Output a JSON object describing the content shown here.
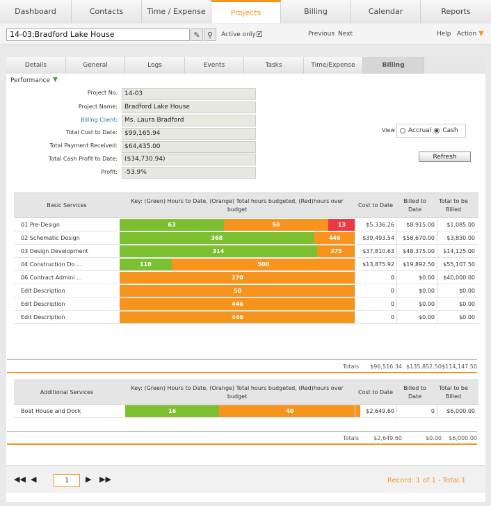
{
  "nav": {
    "tabs": [
      "Dashboard",
      "Contacts",
      "Time / Expense",
      "Projects",
      "Billing",
      "Calendar",
      "Reports"
    ],
    "active": "Projects"
  },
  "toolbar": {
    "project_select": "14-03:Bradford Lake House",
    "active_only": "Active only",
    "active_checked": "✔",
    "previous": "Previous",
    "next": "Next",
    "help": "Help",
    "action": "Action"
  },
  "subtabs": {
    "items": [
      "Details",
      "General",
      "Logs",
      "Events",
      "Tasks",
      "Time/Expense",
      "Billing"
    ],
    "active": "Billing"
  },
  "performance": {
    "label": "Performance",
    "project_no_label": "Project No.",
    "project_no": "14-03",
    "project_name_label": "Project Name:",
    "project_name": "Bradford Lake House",
    "billing_client_label": "Billing Client:",
    "billing_client": "Ms. Laura Bradford",
    "total_cost_label": "Total Cost to Date:",
    "total_cost": "$99,165.94",
    "total_payment_label": "Total Payment Received:",
    "total_payment": "$64,435.00",
    "cash_profit_label": "Total Cash Profit to Date:",
    "cash_profit": "($34,730.94)",
    "profit_label": "Profit:",
    "profit": "-53.9%",
    "view_label": "View",
    "accrual": "Accrual",
    "cash": "Cash",
    "view_selected": "Cash",
    "refresh": "Refresh"
  },
  "colors": {
    "green": "#7cc032",
    "orange": "#f7941d",
    "red": "#ee3942",
    "accent": "#f7941d"
  },
  "basic": {
    "headers": {
      "name": "Basic Services",
      "key": "Key: (Green) Hours to Date, (Orange) Total hours budgeted, (Red)hours over budget",
      "cost": "Cost to Date",
      "billed": "Billed to Date",
      "tobe": "Total to be Billed"
    },
    "rows": [
      {
        "name": "01 Pre-Design",
        "hours": 63,
        "budget": 50,
        "over": 13,
        "cost": "$5,336.26",
        "billed": "$8,915.00",
        "tobe": "$1,085.00"
      },
      {
        "name": "02 Schematic Design",
        "hours": 368,
        "budget": 446,
        "over": null,
        "cost": "$39,493.54",
        "billed": "$58,670.00",
        "tobe": "$3,830.00"
      },
      {
        "name": "03 Design Development",
        "hours": 314,
        "budget": 375,
        "over": null,
        "cost": "$37,810.63",
        "billed": "$48,375.00",
        "tobe": "$14,125.00"
      },
      {
        "name": "04 Construction Do ...",
        "hours": 110,
        "budget": 500,
        "over": null,
        "cost": "$13,875.92",
        "billed": "$19,892.50",
        "tobe": "$55,107.50"
      },
      {
        "name": "06 Contract Admini ...",
        "hours": null,
        "budget": 270,
        "over": null,
        "cost": "0",
        "billed": "$0.00",
        "tobe": "$40,000.00"
      },
      {
        "name": "Edit Description",
        "hours": null,
        "budget": 50,
        "over": null,
        "cost": "0",
        "billed": "$0.00",
        "tobe": "$0.00"
      },
      {
        "name": "Edit Description",
        "hours": null,
        "budget": 446,
        "over": null,
        "cost": "0",
        "billed": "$0.00",
        "tobe": "$0.00"
      },
      {
        "name": "Edit Description",
        "hours": null,
        "budget": 446,
        "over": null,
        "cost": "0",
        "billed": "$0.00",
        "tobe": "$0.00"
      }
    ],
    "totals": {
      "label": "Totals",
      "cost": "$96,516.34",
      "billed": "$135,852.50",
      "tobe": "$114,147.50"
    }
  },
  "additional": {
    "headers": {
      "name": "Additional Services",
      "key": "Key: (Green) Hours to Date, (Orange) Total hours budgeted, (Red)hours over budget",
      "cost": "Cost to Date",
      "billed": "Billed to Date",
      "tobe": "Total to be Billed"
    },
    "rows": [
      {
        "name": "Boat House and Dock",
        "hours": 16,
        "budget": 40,
        "over": null,
        "cost": "$2,649.60",
        "billed": "0",
        "tobe": "$6,000.00"
      }
    ],
    "totals": {
      "label": "Totals",
      "cost": "$2,649.60",
      "billed": "$0.00",
      "tobe": "$6,000.00"
    }
  },
  "pager": {
    "page": "1",
    "record": "Record: 1 of 1 - Total 1"
  }
}
